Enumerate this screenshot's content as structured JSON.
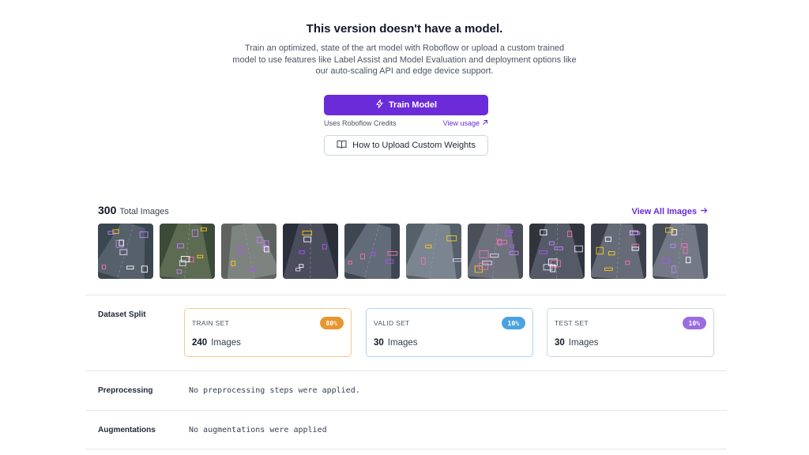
{
  "hero": {
    "title": "This version doesn't have a model.",
    "description_line1": "Train an optimized, state of the art model with Roboflow or upload a custom trained",
    "description_line2": "model to use features like Label Assist and Model Evaluation and deployment options like",
    "description_line3": "our auto-scaling API and edge device support.",
    "train_button_label": "Train Model",
    "credits_text": "Uses Roboflow Credits",
    "view_usage_label": "View usage",
    "upload_button_label": "How to Upload Custom Weights"
  },
  "images": {
    "total_count": "300",
    "total_label": "Total Images",
    "view_all_label": "View All Images",
    "thumbnail_count": 10
  },
  "dataset_split": {
    "label": "Dataset Split",
    "cards": [
      {
        "name": "TRAIN SET",
        "percent": "80%",
        "count": "240",
        "unit": "Images",
        "color": "#e8962f",
        "border": "#f5c98e"
      },
      {
        "name": "VALID SET",
        "percent": "10%",
        "count": "30",
        "unit": "Images",
        "color": "#4aa3e0",
        "border": "#a9d4f2"
      },
      {
        "name": "TEST SET",
        "percent": "10%",
        "count": "30",
        "unit": "Images",
        "color": "#9c6de0",
        "border": "#cbd5e1"
      }
    ]
  },
  "preprocessing": {
    "label": "Preprocessing",
    "value": "No preprocessing steps were applied."
  },
  "augmentations": {
    "label": "Augmentations",
    "value": "No augmentations were applied"
  },
  "colors": {
    "accent": "#6b2bd9"
  }
}
